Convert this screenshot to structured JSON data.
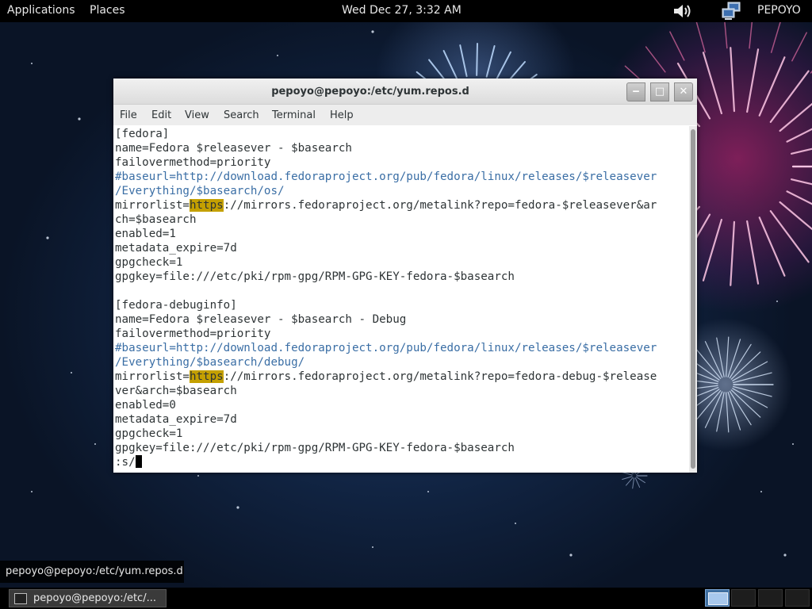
{
  "top_panel": {
    "applications": "Applications",
    "places": "Places",
    "clock": "Wed Dec 27,  3:32 AM",
    "user": "PEPOYO",
    "volume_icon": "speaker-volume-icon",
    "network_icon": "network-computers-icon"
  },
  "window": {
    "title": "pepoyo@pepoyo:/etc/yum.repos.d",
    "buttons": {
      "minimize": "‒",
      "maximize": "□",
      "close": "✕"
    },
    "menu": [
      "File",
      "Edit",
      "View",
      "Search",
      "Terminal",
      "Help"
    ]
  },
  "terminal": {
    "lines": [
      {
        "text": "[fedora]"
      },
      {
        "text": "name=Fedora $releasever - $basearch"
      },
      {
        "text": "failovermethod=priority"
      },
      {
        "text": "#baseurl=http://download.fedoraproject.org/pub/fedora/linux/releases/$releasever",
        "type": "comment"
      },
      {
        "text": "/Everything/$basearch/os/",
        "type": "comment"
      },
      {
        "text": "mirrorlist=",
        "highlight": "https",
        "rest": "://mirrors.fedoraproject.org/metalink?repo=fedora-$releasever&ar"
      },
      {
        "text": "ch=$basearch"
      },
      {
        "text": "enabled=1"
      },
      {
        "text": "metadata_expire=7d"
      },
      {
        "text": "gpgcheck=1"
      },
      {
        "text": "gpgkey=file:///etc/pki/rpm-gpg/RPM-GPG-KEY-fedora-$basearch"
      },
      {
        "text": ""
      },
      {
        "text": "[fedora-debuginfo]"
      },
      {
        "text": "name=Fedora $releasever - $basearch - Debug"
      },
      {
        "text": "failovermethod=priority"
      },
      {
        "text": "#baseurl=http://download.fedoraproject.org/pub/fedora/linux/releases/$releasever",
        "type": "comment"
      },
      {
        "text": "/Everything/$basearch/debug/",
        "type": "comment"
      },
      {
        "text": "mirrorlist=",
        "highlight": "https",
        "rest": "://mirrors.fedoraproject.org/metalink?repo=fedora-debug-$release"
      },
      {
        "text": "ver&arch=$basearch"
      },
      {
        "text": "enabled=0"
      },
      {
        "text": "metadata_expire=7d"
      },
      {
        "text": "gpgcheck=1"
      },
      {
        "text": "gpgkey=file:///etc/pki/rpm-gpg/RPM-GPG-KEY-fedora-$basearch"
      },
      {
        "text": ":s/",
        "cursor": true
      }
    ],
    "highlight_color": "#c4a000",
    "comment_color": "#3a6ea5"
  },
  "tooltip": {
    "text": "pepoyo@pepoyo:/etc/yum.repos.d"
  },
  "taskbar": {
    "task_label": "pepoyo@pepoyo:/etc/...",
    "task_icon": "terminal-icon",
    "workspaces": 4,
    "active_workspace": 1
  }
}
